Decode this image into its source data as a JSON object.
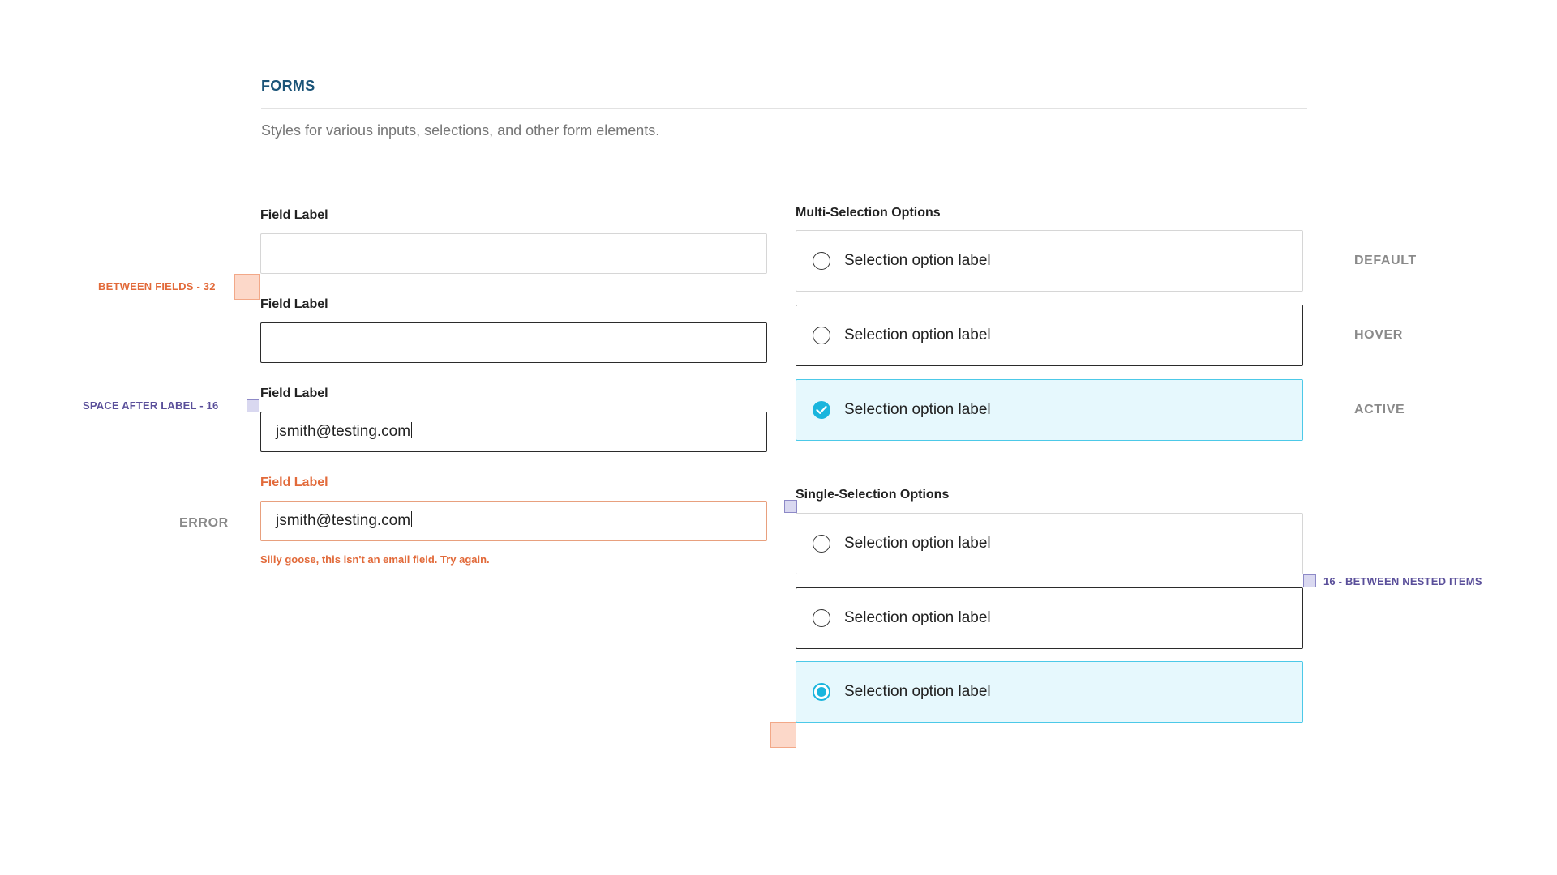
{
  "section": {
    "title": "FORMS",
    "description": "Styles for various inputs, selections, and other form elements."
  },
  "fields": [
    {
      "label": "Field Label",
      "value": "",
      "state": "default"
    },
    {
      "label": "Field Label",
      "value": "",
      "state": "hover"
    },
    {
      "label": "Field Label",
      "value": "jsmith@testing.com",
      "state": "active"
    },
    {
      "label": "Field Label",
      "value": "jsmith@testing.com",
      "state": "error",
      "error_message": "Silly goose, this isn't an email field. Try again."
    }
  ],
  "multi_selection": {
    "title": "Multi-Selection Options",
    "options": [
      {
        "label": "Selection option label",
        "state": "default"
      },
      {
        "label": "Selection option label",
        "state": "hover"
      },
      {
        "label": "Selection option label",
        "state": "active",
        "checked": true
      }
    ]
  },
  "single_selection": {
    "title": "Single-Selection Options",
    "options": [
      {
        "label": "Selection option label",
        "state": "default"
      },
      {
        "label": "Selection option label",
        "state": "hover"
      },
      {
        "label": "Selection option label",
        "state": "active",
        "checked": true
      }
    ]
  },
  "state_labels": {
    "default": "DEFAULT",
    "hover": "HOVER",
    "active": "ACTIVE",
    "error": "ERROR"
  },
  "annotations": {
    "between_fields": "BETWEEN FIELDS - 32",
    "space_after_label": "SPACE AFTER LABEL - 16",
    "between_nested": "16 - BETWEEN NESTED ITEMS"
  },
  "colors": {
    "accent": "#1ab5dd",
    "active_bg": "#e6f8fd",
    "error": "#e26a3a",
    "title": "#1b5478",
    "annotation_purple": "#5a4f9a"
  }
}
